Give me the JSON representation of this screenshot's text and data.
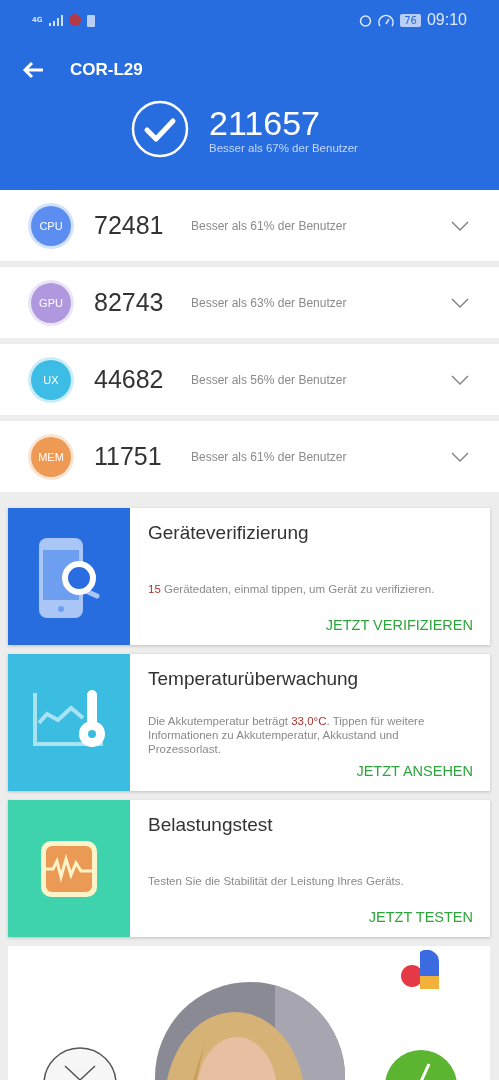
{
  "status_bar": {
    "network": "4G",
    "battery": "76",
    "time": "09:10"
  },
  "header": {
    "title": "COR-L29",
    "total_score": "211657",
    "total_rank": "Besser als 67% der Benutzer"
  },
  "scores": [
    {
      "label": "CPU",
      "color": "#5b8ef0",
      "score": "72481",
      "rank": "Besser als 61% der Benutzer"
    },
    {
      "label": "GPU",
      "color": "#af98de",
      "score": "82743",
      "rank": "Besser als 63% der Benutzer"
    },
    {
      "label": "UX",
      "color": "#3dbde6",
      "score": "44682",
      "rank": "Besser als 56% der Benutzer"
    },
    {
      "label": "MEM",
      "color": "#ee9a55",
      "score": "11751",
      "rank": "Besser als 61% der Benutzer"
    }
  ],
  "cards": [
    {
      "kind": "verify",
      "color": "#286de0",
      "title": "Geräteverifizierung",
      "description": {
        "highlight": "15",
        "after": " Gerätedaten, einmal tippen, um Gerät zu verifizieren."
      },
      "action": "JETZT VERIFIZIEREN"
    },
    {
      "kind": "temperature",
      "color": "#3bbde2",
      "title": "Temperaturüberwachung",
      "description": {
        "before": "Die Akkutemperatur beträgt ",
        "highlight": "33,0°C",
        "after": ". Tippen für weitere Informationen zu Akkutemperatur, Akkustand und Prozessorlast."
      },
      "action": "JETZT ANSEHEN"
    },
    {
      "kind": "stress",
      "color": "#3fd3ad",
      "title": "Belastungstest",
      "description": {
        "before": "Testen Sie die Stabilität der Leistung Ihres Geräts."
      },
      "action": "JETZT TESTEN"
    }
  ]
}
